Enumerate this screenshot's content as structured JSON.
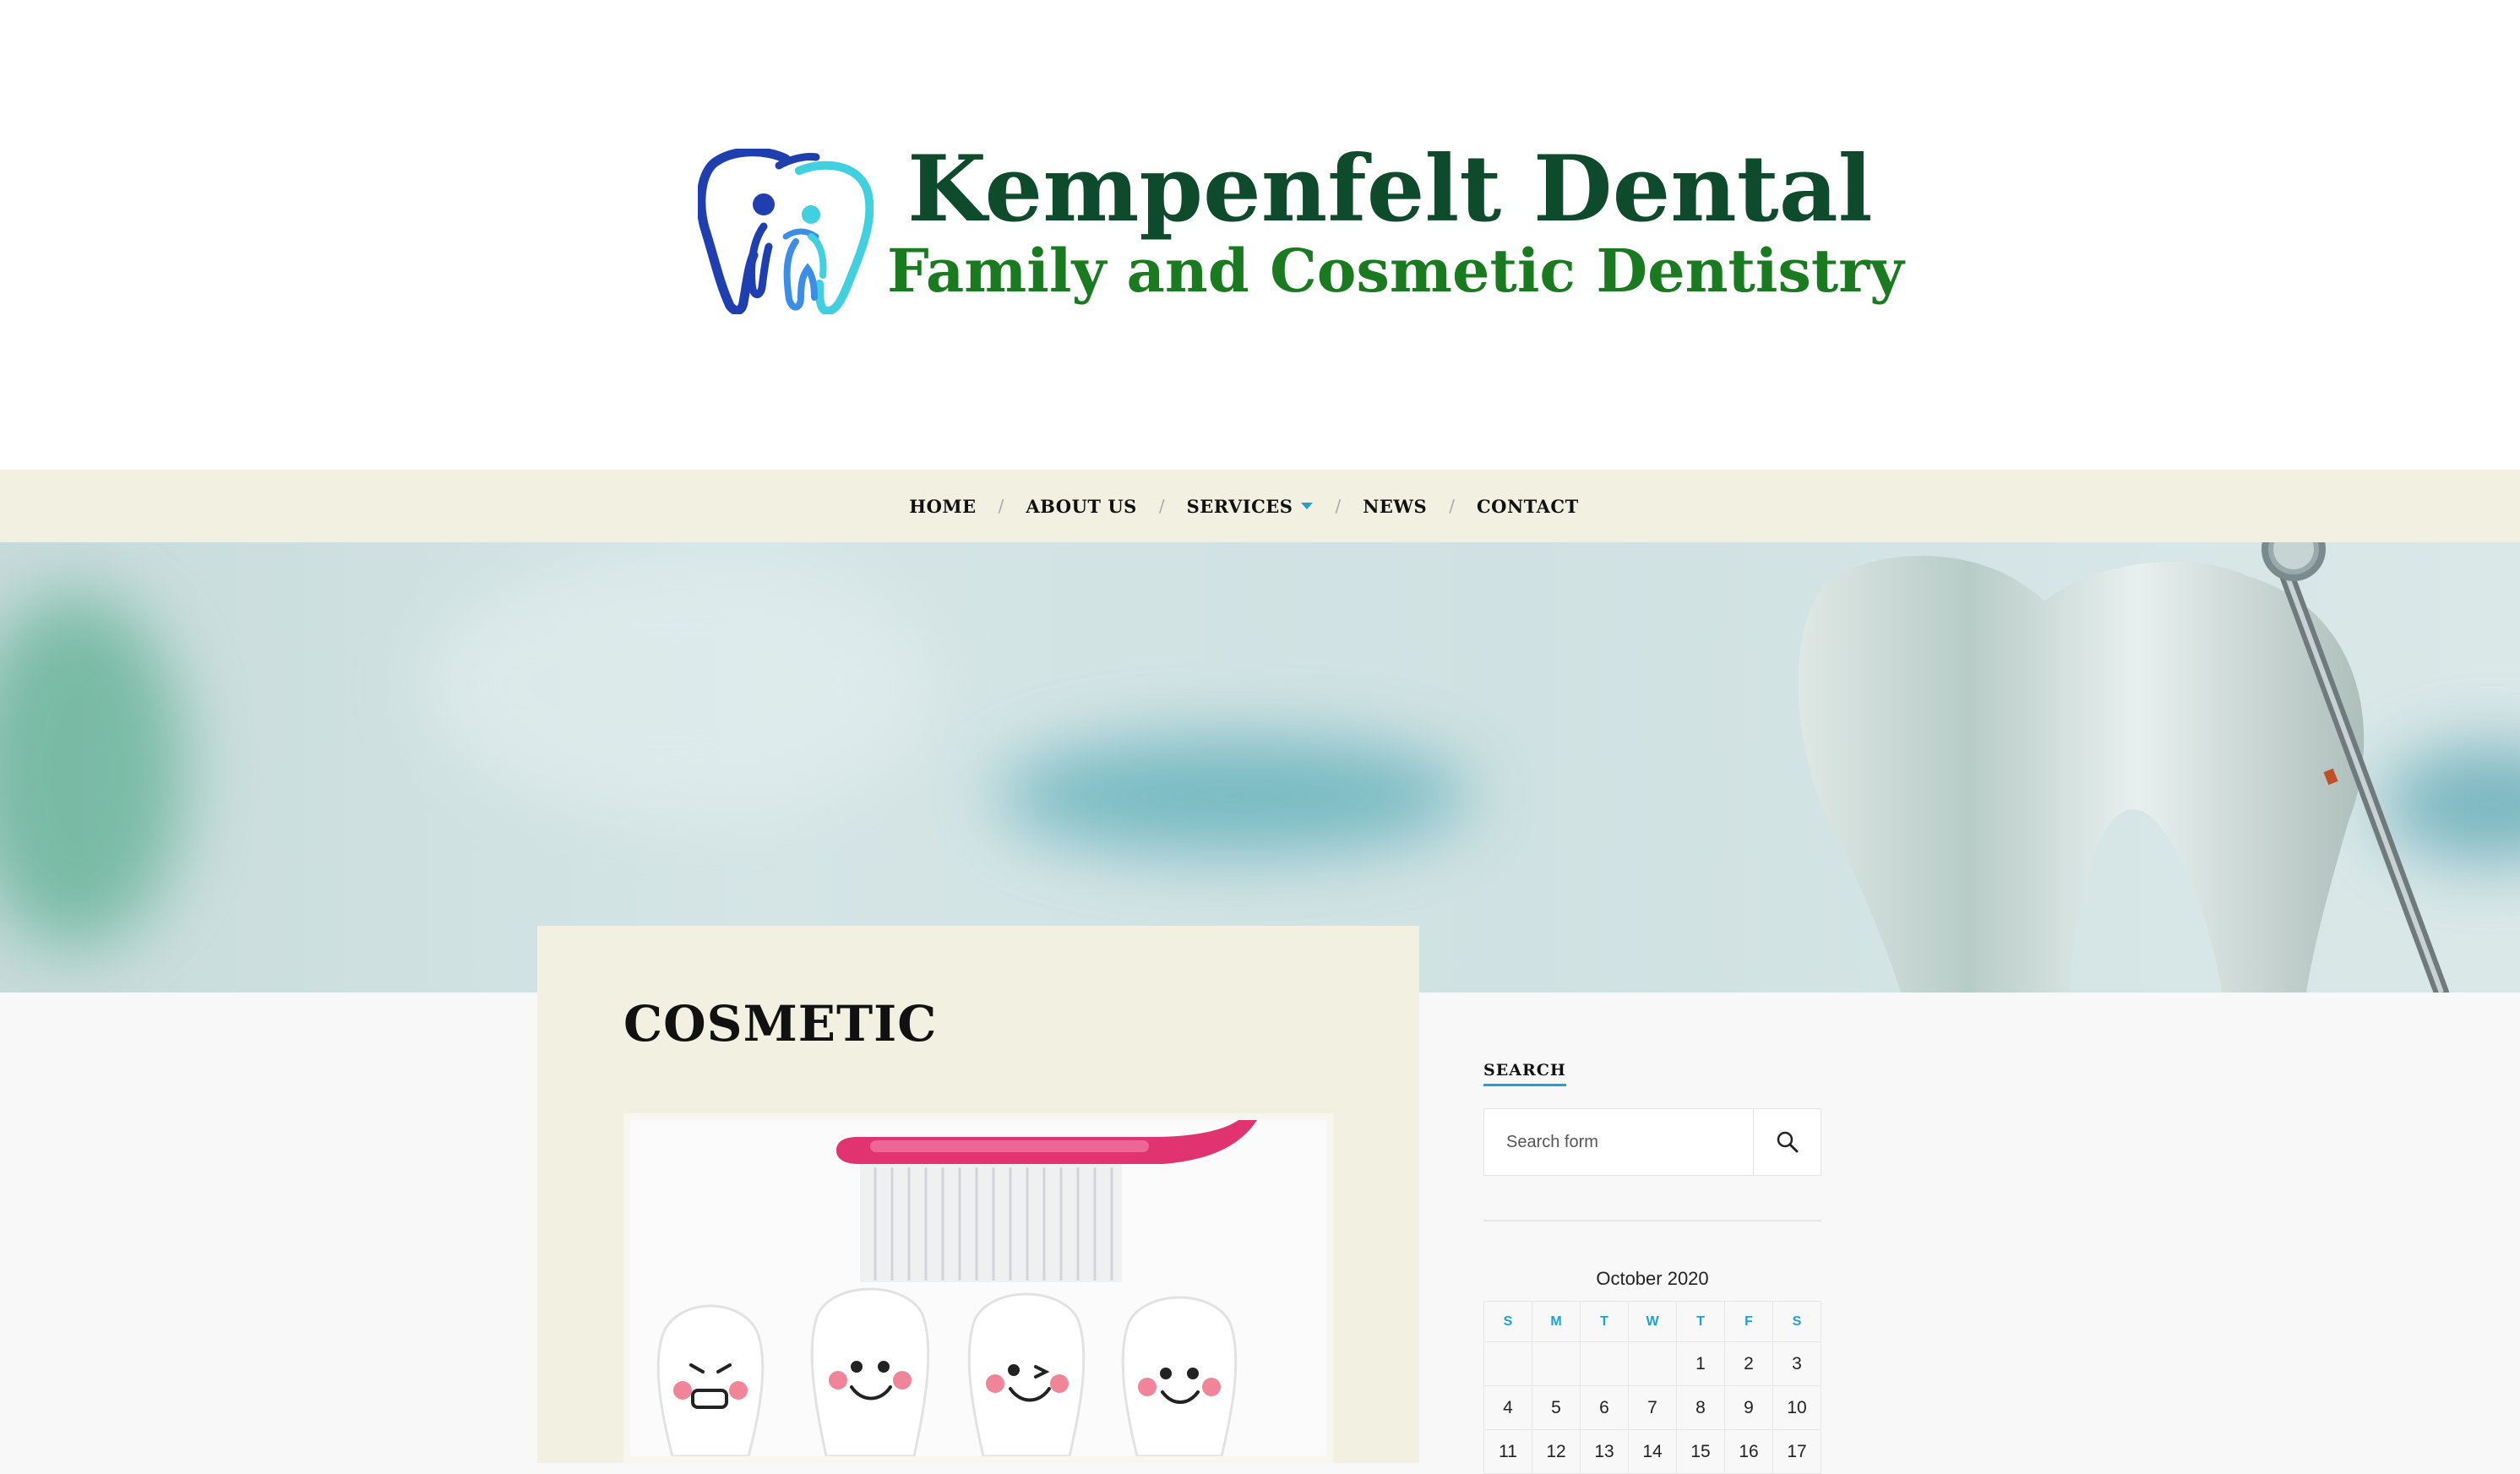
{
  "header": {
    "logo_title": "Kempenfelt Dental",
    "logo_subtitle": "Family and Cosmetic Dentistry",
    "logo_colors": {
      "title": "#0e4a2c",
      "subtitle": "#1a7a1f",
      "tooth_dark": "#1f3fb0",
      "tooth_light": "#40d0e0"
    }
  },
  "nav": {
    "items": [
      {
        "label": "HOME"
      },
      {
        "label": "ABOUT US"
      },
      {
        "label": "SERVICES",
        "has_dropdown": true
      },
      {
        "label": "NEWS"
      },
      {
        "label": "CONTACT"
      }
    ],
    "separator": "/",
    "accent_color": "#1ba0d8"
  },
  "page": {
    "title": "COSMETIC"
  },
  "sidebar": {
    "search": {
      "title": "SEARCH",
      "placeholder": "Search form",
      "button_icon": "search-icon"
    },
    "calendar": {
      "caption": "October 2020",
      "weekdays": [
        "S",
        "M",
        "T",
        "W",
        "T",
        "F",
        "S"
      ],
      "weeks": [
        [
          "",
          "",
          "",
          "",
          "1",
          "2",
          "3"
        ],
        [
          "4",
          "5",
          "6",
          "7",
          "8",
          "9",
          "10"
        ],
        [
          "11",
          "12",
          "13",
          "14",
          "15",
          "16",
          "17"
        ]
      ]
    }
  }
}
